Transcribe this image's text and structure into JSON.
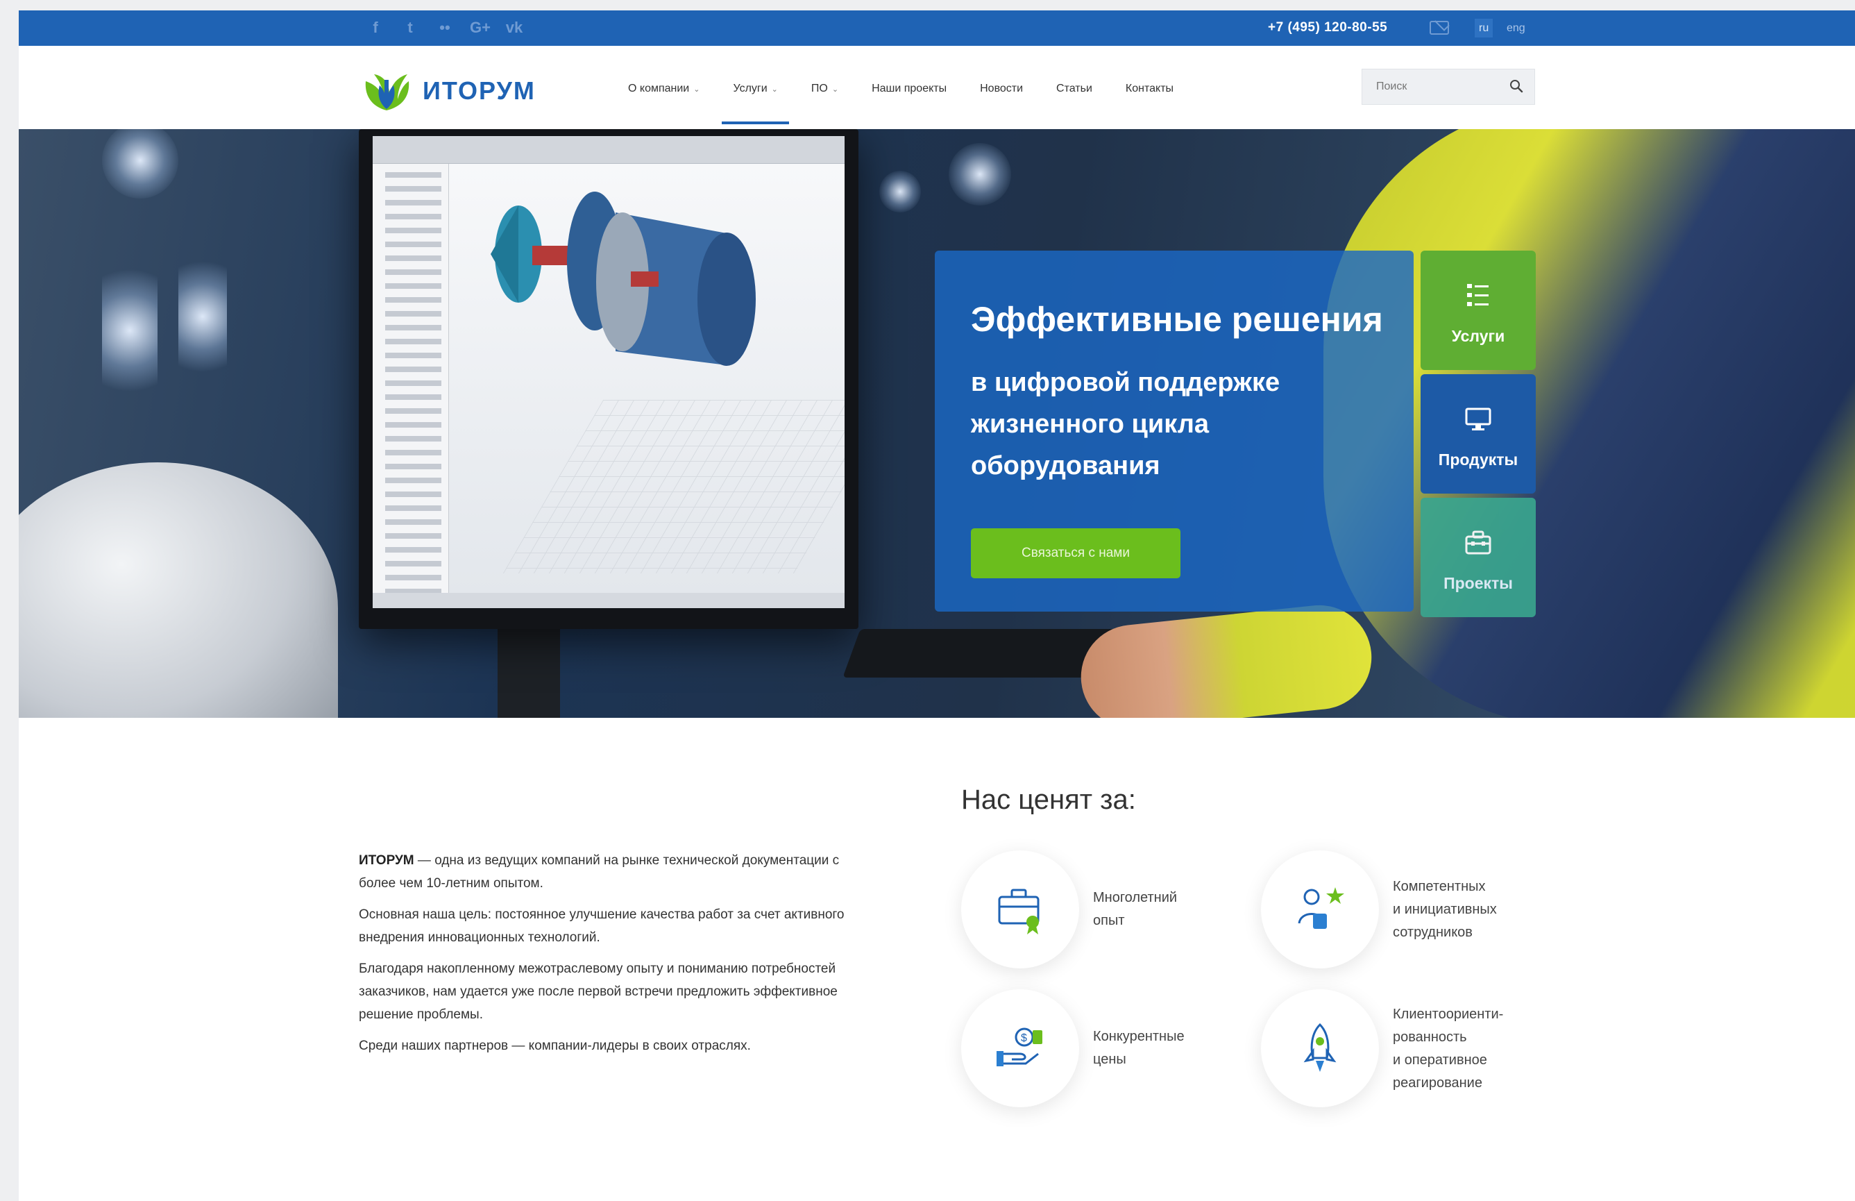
{
  "topbar": {
    "social": [
      "f",
      "t",
      "••",
      "G+",
      "vk"
    ],
    "phone": "+7 (495) 120-80-55",
    "lang_ru": "ru",
    "lang_eng": "eng"
  },
  "header": {
    "logo_text": "ИТОРУМ",
    "nav": [
      {
        "label": "О компании",
        "caret": "⌄"
      },
      {
        "label": "Услуги",
        "caret": "⌄"
      },
      {
        "label": "ПО",
        "caret": "⌄"
      },
      {
        "label": "Наши проекты"
      },
      {
        "label": "Новости"
      },
      {
        "label": "Статьи"
      },
      {
        "label": "Контакты"
      }
    ],
    "search_placeholder": "Поиск"
  },
  "hero": {
    "title": "Эффективные решения",
    "subtitle": "в цифровой поддержке жизненного цикла оборудования",
    "cta": "Связаться с нами",
    "tiles": {
      "services": "Услуги",
      "products": "Продукты",
      "projects": "Проекты"
    }
  },
  "about": {
    "brand": "ИТОРУМ",
    "p1_rest": " — одна из ведущих компаний на рынке технической документации с более чем 10-летним опытом.",
    "p2": "Основная наша цель: постоянное улучшение качества работ за счет активного внедрения инновационных технологий.",
    "p3": "Благодаря накопленному межотраслевому опыту и пониманию потребностей заказчиков, нам удается уже после первой встречи предложить эффективное решение проблемы.",
    "p4": "Среди наших партнеров — компании-лидеры в своих отраслях."
  },
  "values": {
    "title": "Нас ценят за:",
    "items": [
      {
        "text_l1": "Многолетний",
        "text_l2": "опыт"
      },
      {
        "text_l1": "Компетентных",
        "text_l2": "и инициативных",
        "text_l3": "сотрудников"
      },
      {
        "text_l1": "Конкурентные",
        "text_l2": "цены"
      },
      {
        "text_l1": "Клиентоориенти-",
        "text_l2": "рованность",
        "text_l3": "и оперативное",
        "text_l4": "реагирование"
      }
    ]
  },
  "colors": {
    "brand_blue": "#1f63b4",
    "accent_green": "#6bbe1d",
    "tile_green": "#5fae33"
  }
}
